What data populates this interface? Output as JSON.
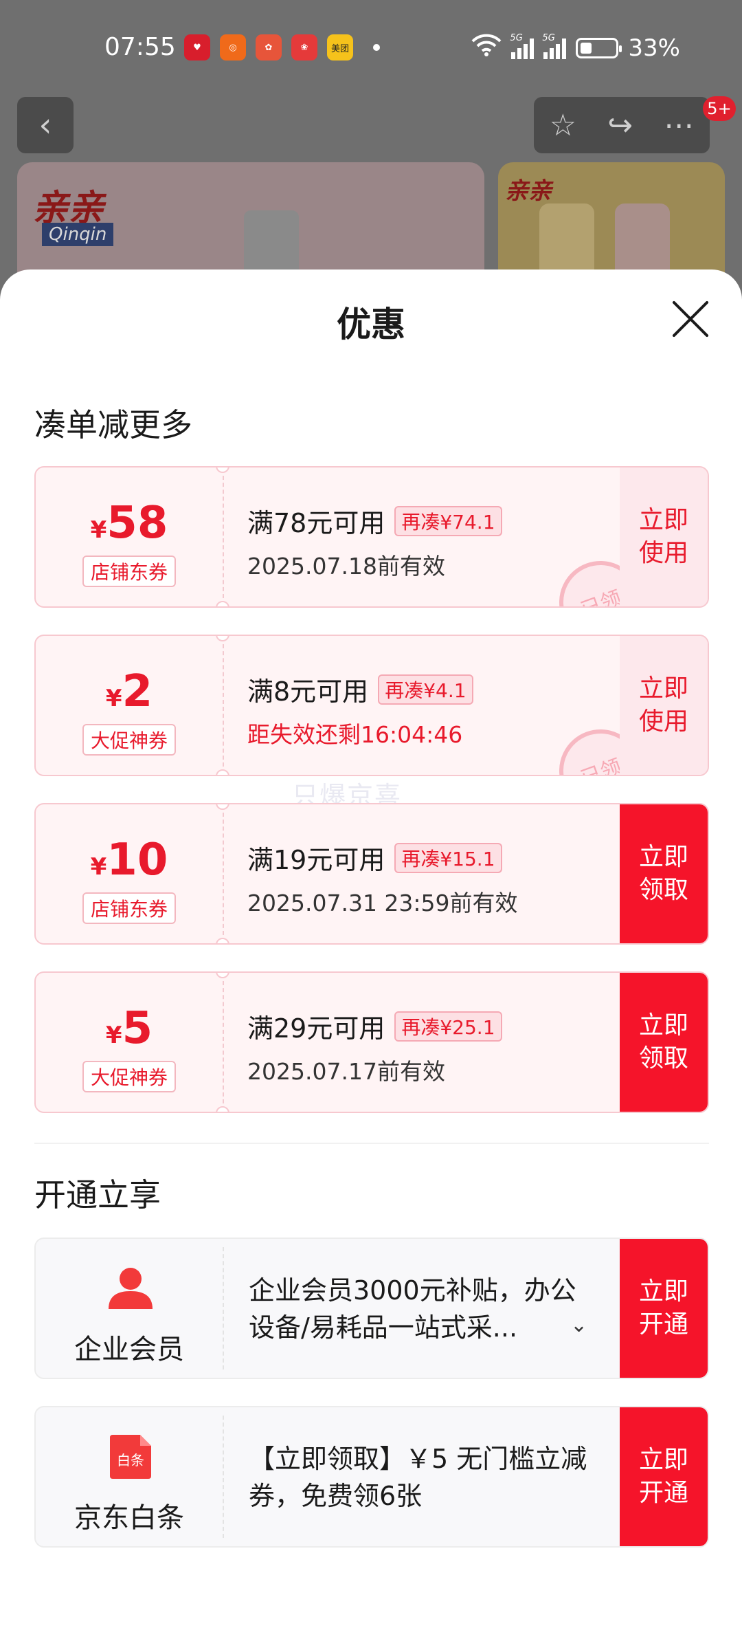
{
  "status_bar": {
    "time": "07:55",
    "apps": [
      {
        "name": "app-icon-1",
        "color": "#d81e2c"
      },
      {
        "name": "app-icon-2",
        "color": "#f06a1a"
      },
      {
        "name": "app-icon-3",
        "color": "#e7553a"
      },
      {
        "name": "app-icon-4",
        "color": "#e53a3a"
      },
      {
        "name": "meituan-icon",
        "color": "#f6c21b",
        "label": "美团"
      }
    ],
    "network_label": "5G",
    "battery": "33%",
    "battery_level": 0.33
  },
  "background_page": {
    "cart_badge": "5+",
    "brand_logo": "亲亲",
    "brand_sub": "Qinqin"
  },
  "sheet": {
    "title": "优惠",
    "section_coupons": "凑单减更多",
    "section_services": "开通立享",
    "watermark": "只爆京喜"
  },
  "coupons": [
    {
      "currency": "¥",
      "amount": "58",
      "tag": "店铺东券",
      "condition": "满78元可用",
      "chip": "再凑¥74.1",
      "expiry": "2025.07.18前有效",
      "expiry_red": false,
      "button": "立即使用",
      "claimed": true,
      "stamp": "已领"
    },
    {
      "currency": "¥",
      "amount": "2",
      "tag": "大促神券",
      "condition": "满8元可用",
      "chip": "再凑¥4.1",
      "expiry": "距失效还剩16:04:46",
      "expiry_red": true,
      "button": "立即使用",
      "claimed": true,
      "stamp": "已领"
    },
    {
      "currency": "¥",
      "amount": "10",
      "tag": "店铺东券",
      "condition": "满19元可用",
      "chip": "再凑¥15.1",
      "expiry": "2025.07.31 23:59前有效",
      "expiry_red": false,
      "button": "立即领取",
      "claimed": false,
      "stamp": ""
    },
    {
      "currency": "¥",
      "amount": "5",
      "tag": "大促神券",
      "condition": "满29元可用",
      "chip": "再凑¥25.1",
      "expiry": "2025.07.17前有效",
      "expiry_red": false,
      "button": "立即领取",
      "claimed": false,
      "stamp": ""
    }
  ],
  "services": [
    {
      "name": "企业会员",
      "icon": "person-icon",
      "description": "企业会员3000元补贴，办公设备/易耗品一站式采...",
      "button": "立即开通",
      "expandable": true
    },
    {
      "name": "京东白条",
      "icon": "baitiao-icon",
      "icon_text": "白条",
      "description": "【立即领取】￥5 无门槛立减券，免费领6张",
      "button": "立即开通",
      "expandable": false
    }
  ],
  "colors": {
    "accent": "#f5142a",
    "accent_text": "#e81a2c",
    "coupon_bg": "#fff4f5"
  }
}
